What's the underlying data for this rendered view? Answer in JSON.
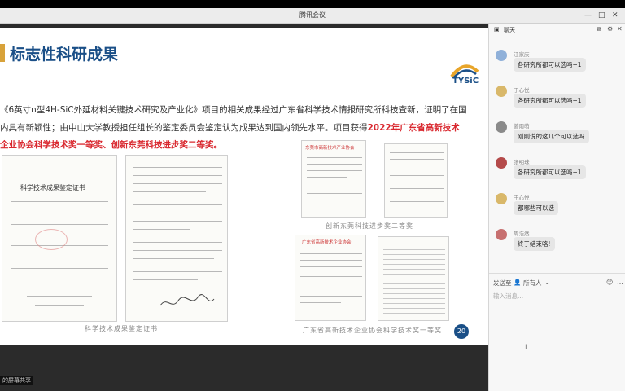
{
  "window": {
    "title": "腾讯会议"
  },
  "slide": {
    "title": "标志性科研成果",
    "logo_text": "TYSiC",
    "para_line1": "《6英寸n型4H-SiC外延材料关键技术研究及产业化》项目的相关成果经过广东省科学技术情报研究所科技查新，证明了在国",
    "para_line2a": "内具有新颖性；由中山大学教授担任组长的鉴定委员会鉴定认为成果达到国内领先水平。项目获得",
    "para_line2b": "2022年广东省高新技术",
    "para_line3": "企业协会科学技术奖一等奖、创新东莞科技进步奖二等奖。",
    "cert1_heading": "科学技术成果鉴定证书",
    "cert3_heading": "东莞市高新技术产业协会",
    "cert4_heading": "广东省高新技术企业协会",
    "caption_left": "科学技术成果鉴定证书",
    "caption_mid": "创新东莞科技进步奖二等奖",
    "caption_right": "广东省高新技术企业协会科学技术奖一等奖",
    "page_number": "20"
  },
  "share_label": "的屏幕共享",
  "chat": {
    "header": "聊天",
    "messages": [
      {
        "name": "江家庆",
        "text": "各研究所都可以选吗+1",
        "color": "#8fb0d9"
      },
      {
        "name": "于心悦",
        "text": "各研究所都可以选吗+1",
        "color": "#d9b86a"
      },
      {
        "name": "姜雨萌",
        "text": "刚刚说的这几个可以选吗",
        "color": "#8a8a8a"
      },
      {
        "name": "张明珠",
        "text": "各研究所都可以选吗+1",
        "color": "#b44a4a"
      },
      {
        "name": "于心悦",
        "text": "都哪些可以选",
        "color": "#d9b86a"
      },
      {
        "name": "周浩然",
        "text": "终于结束咯!",
        "color": "#c77070"
      }
    ],
    "send_to_label": "发送至",
    "send_to_value": "所有人",
    "input_placeholder": "输入消息..."
  }
}
